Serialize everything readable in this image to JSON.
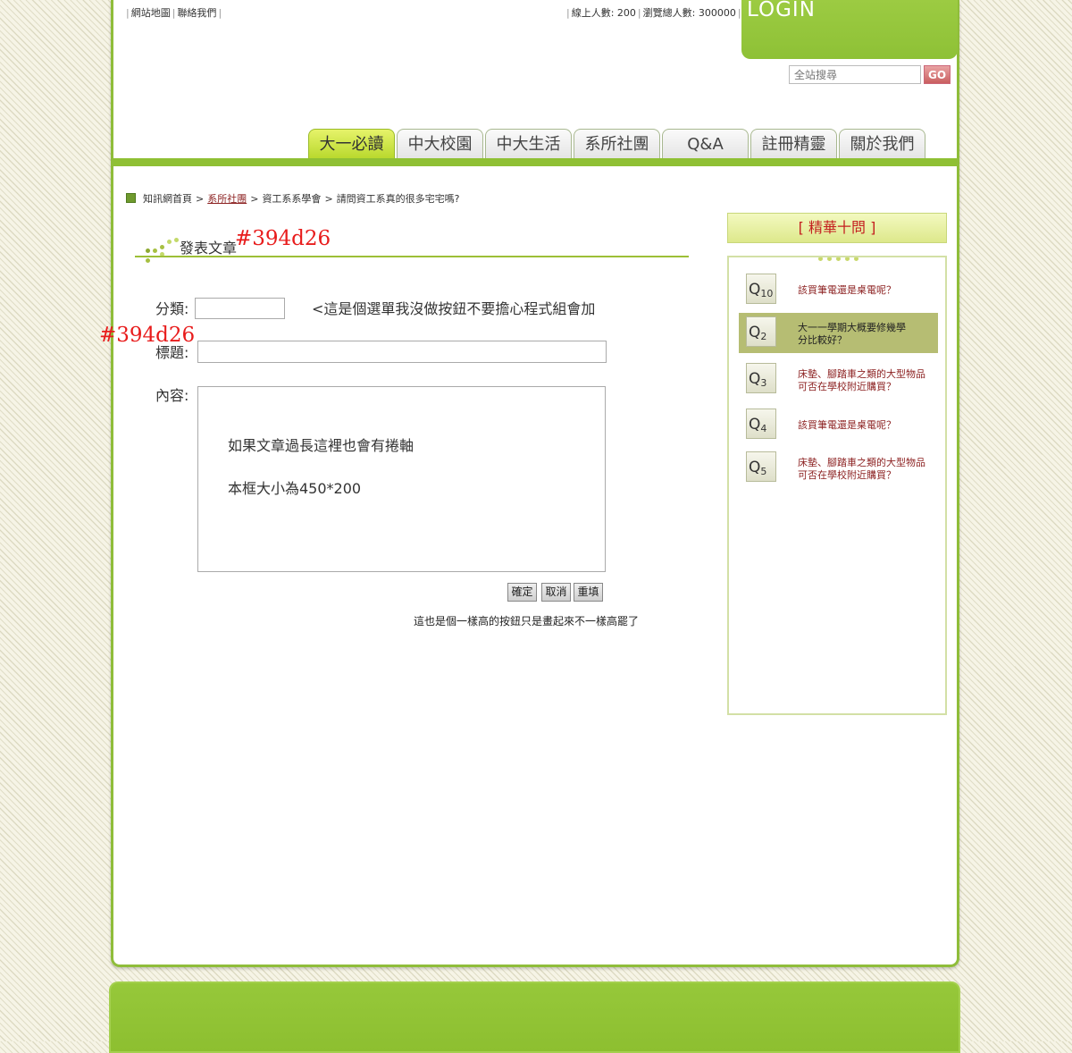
{
  "header": {
    "top_links": [
      "網站地圖",
      "聯絡我們"
    ],
    "stats": [
      "線上人數: 200",
      "瀏覽總人數: 300000"
    ],
    "login_label": "LOGIN",
    "search_placeholder": "全站搜尋",
    "go_label": "GO"
  },
  "nav": {
    "tabs": [
      "大一必讀",
      "中大校園",
      "中大生活",
      "系所社團",
      "Q&A",
      "註冊精靈",
      "關於我們"
    ],
    "active_tab": 0
  },
  "breadcrumb": {
    "home": "知訊網首頁",
    "section": "系所社團",
    "sub": "資工系系學會",
    "page": "請問資工系真的很多宅宅嗎?"
  },
  "form": {
    "heading": "發表文章",
    "category_label": "分類:",
    "category_note": "<這是個選單我沒做按鈕不要擔心程式組會加",
    "title_label": "標題:",
    "content_label": "內容:",
    "content_line1": "如果文章過長這裡也會有捲軸",
    "content_line2": "本框大小為450*200",
    "buttons": [
      "確定",
      "取消",
      "重填"
    ],
    "button_note": "這也是個一樣高的按鈕只是畫起來不一樣高罷了"
  },
  "annotations": {
    "color1": "#394d26",
    "color2": "#394d26"
  },
  "faq": {
    "heading": "[ 精華十問 ]",
    "items": [
      {
        "q": "Q",
        "num": "10",
        "text": "該買筆電還是桌電呢？"
      },
      {
        "q": "Q",
        "num": "2",
        "text": "大一一學期大概要修幾學分比較好？"
      },
      {
        "q": "Q",
        "num": "3",
        "text": "床墊、腳踏車之類的大型物品可否在學校附近購買？"
      },
      {
        "q": "Q",
        "num": "4",
        "text": "該買筆電還是桌電呢？"
      },
      {
        "q": "Q",
        "num": "5",
        "text": "床墊、腳踏車之類的大型物品可否在學校附近購買？"
      }
    ]
  }
}
